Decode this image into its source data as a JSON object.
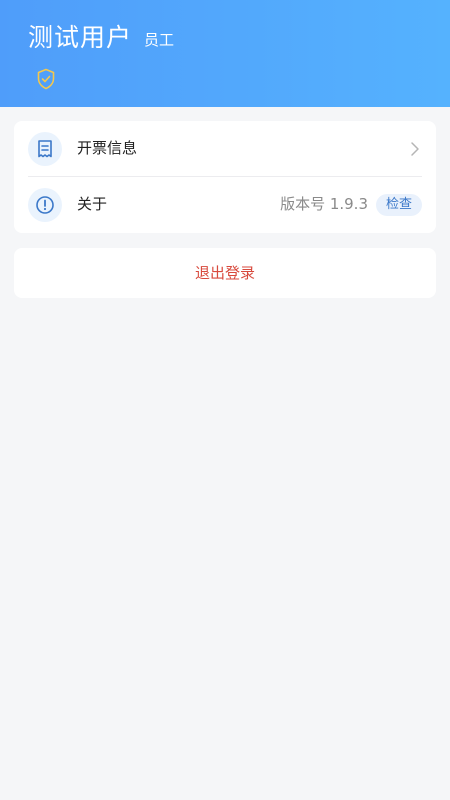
{
  "header": {
    "user_name": "测试用户",
    "user_role": "员工",
    "verified_icon": "shield-check-icon"
  },
  "menu": {
    "items": [
      {
        "label": "开票信息",
        "icon": "receipt-icon",
        "trailing_icon": "chevron-right-icon"
      },
      {
        "label": "关于",
        "icon": "info-exclamation-icon",
        "version_text": "版本号 1.9.3",
        "action_label": "检查"
      }
    ]
  },
  "logout": {
    "label": "退出登录"
  },
  "colors": {
    "header_gradient_start": "#4f9dfa",
    "header_gradient_end": "#55b2fe",
    "accent_blue": "#3b78c9",
    "logout_red": "#d84a3d",
    "verified_gold": "#f5c84c",
    "background": "#f5f6f8"
  }
}
